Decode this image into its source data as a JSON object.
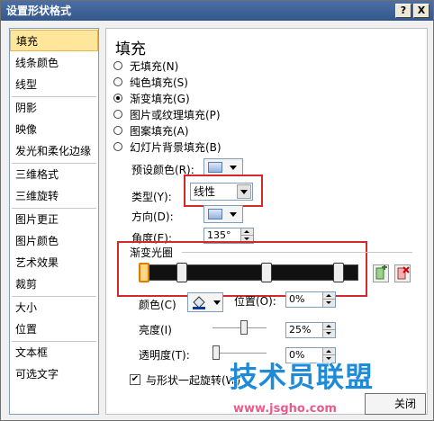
{
  "window": {
    "title": "设置形状格式",
    "help_glyph": "?",
    "close_glyph": "X"
  },
  "sidebar": {
    "items": [
      {
        "label": "填充",
        "selected": true
      },
      {
        "label": "线条颜色"
      },
      {
        "label": "线型"
      },
      {
        "label": "阴影"
      },
      {
        "label": "映像"
      },
      {
        "label": "发光和柔化边缘"
      },
      {
        "label": "三维格式"
      },
      {
        "label": "三维旋转"
      },
      {
        "label": "图片更正"
      },
      {
        "label": "图片颜色"
      },
      {
        "label": "艺术效果"
      },
      {
        "label": "裁剪"
      },
      {
        "label": "大小"
      },
      {
        "label": "位置"
      },
      {
        "label": "文本框"
      },
      {
        "label": "可选文字"
      }
    ]
  },
  "panel": {
    "heading": "填充",
    "fill_options": [
      {
        "label": "无填充(N)",
        "checked": false
      },
      {
        "label": "纯色填充(S)",
        "checked": false
      },
      {
        "label": "渐变填充(G)",
        "checked": true
      },
      {
        "label": "图片或纹理填充(P)",
        "checked": false
      },
      {
        "label": "图案填充(A)",
        "checked": false
      },
      {
        "label": "幻灯片背景填充(B)",
        "checked": false
      }
    ],
    "preset_label": "预设颜色(R):",
    "type_label": "类型(Y):",
    "type_value": "线性",
    "direction_label": "方向(D):",
    "angle_label": "角度(E):",
    "angle_value": "135°",
    "gradient_stops_label": "渐变光圈",
    "color_label": "颜色(C)",
    "position_label": "位置(O):",
    "position_value": "0%",
    "brightness_label": "亮度(I)",
    "brightness_value": "25%",
    "transparency_label": "透明度(T):",
    "transparency_value": "0%",
    "rotate_label": "与形状一起旋转(W)",
    "rotate_checked": true,
    "brightness_level": 0.6,
    "transparency_level": 0.0
  },
  "footer": {
    "close_label": "关闭"
  },
  "watermark": {
    "text": "技术员联盟",
    "url": "www.jsgho.com"
  },
  "colors": {
    "highlight": "#d22a2a",
    "selected_item": "#ffe69a",
    "title_bar": "#35578c"
  }
}
